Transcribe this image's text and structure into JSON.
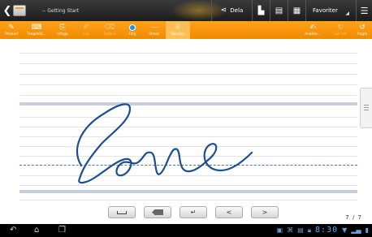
{
  "titlebar": {
    "title": "-- Getting Start",
    "share_label": "Dela",
    "favorites_label": "Favoriter"
  },
  "toolbar": {
    "left": [
      {
        "id": "tool-read",
        "label": "Prtsand",
        "icon": "eye-pen-icon",
        "dim": false,
        "active": false
      },
      {
        "id": "tool-keyboard",
        "label": "Tangentb...",
        "icon": "keyboard-icon",
        "dim": false,
        "active": false
      },
      {
        "id": "tool-insert",
        "label": "Infoga",
        "icon": "insert-icon",
        "dim": false,
        "active": false
      },
      {
        "id": "tool-pen",
        "label": "Linj",
        "icon": "pen-icon",
        "dim": true,
        "active": false
      },
      {
        "id": "tool-eraser",
        "label": "Radera",
        "icon": "eraser-icon",
        "dim": true,
        "active": false
      },
      {
        "id": "tool-color",
        "label": "Färg",
        "icon": "color-dot-icon",
        "dim": false,
        "active": false
      },
      {
        "id": "tool-stroke",
        "label": "Streck",
        "icon": "stroke-icon",
        "dim": false,
        "active": false
      },
      {
        "id": "tool-baseline",
        "label": "Baslinje",
        "icon": "baseline-icon",
        "dim": false,
        "active": true
      }
    ],
    "right": [
      {
        "id": "tool-analyze",
        "label": "Analise...",
        "icon": "analyze-icon",
        "dim": false
      },
      {
        "id": "tool-redo",
        "label": "Gör om",
        "icon": "redo-icon",
        "dim": true
      },
      {
        "id": "tool-undo",
        "label": "Ångra",
        "icon": "undo-icon",
        "dim": false
      }
    ],
    "color_value": "#1a8ff0"
  },
  "handwriting": {
    "stroke_color": "#1b4f8f"
  },
  "keys": [
    {
      "id": "space-key",
      "icon": "space-icon"
    },
    {
      "id": "backspace-key",
      "icon": "backspace-icon"
    },
    {
      "id": "enter-key",
      "glyph": "↵"
    },
    {
      "id": "prev-key",
      "glyph": "<"
    },
    {
      "id": "next-key",
      "glyph": ">"
    }
  ],
  "page_count": "7 / 7",
  "sysbar": {
    "clock": "8:30"
  }
}
